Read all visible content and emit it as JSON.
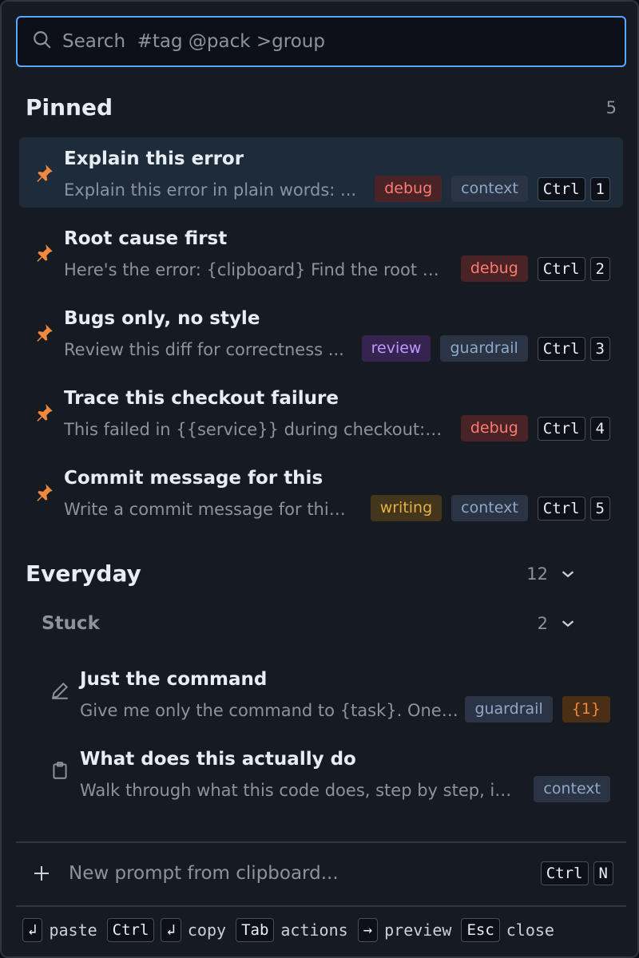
{
  "search": {
    "placeholder": "Search  #tag @pack >group",
    "value": ""
  },
  "pinned": {
    "title": "Pinned",
    "count": "5",
    "items": [
      {
        "title": "Explain this error",
        "desc": "Explain this error in plain words: ...",
        "tags": [
          "debug",
          "context"
        ],
        "keys": [
          "Ctrl",
          "1"
        ]
      },
      {
        "title": "Root cause first",
        "desc": "Here's the error: {clipboard} Find the root c...",
        "tags": [
          "debug"
        ],
        "keys": [
          "Ctrl",
          "2"
        ]
      },
      {
        "title": "Bugs only, no style",
        "desc": "Review this diff for correctness ...",
        "tags": [
          "review",
          "guardrail"
        ],
        "keys": [
          "Ctrl",
          "3"
        ]
      },
      {
        "title": "Trace this checkout failure",
        "desc": "This failed in {{service}} during checkout: {cl...",
        "tags": [
          "debug"
        ],
        "keys": [
          "Ctrl",
          "4"
        ]
      },
      {
        "title": "Commit message for this",
        "desc": "Write a commit message for this...",
        "tags": [
          "writing",
          "context"
        ],
        "keys": [
          "Ctrl",
          "5"
        ]
      }
    ]
  },
  "everyday": {
    "title": "Everyday",
    "count": "12",
    "group": {
      "title": "Stuck",
      "count": "2",
      "items": [
        {
          "title": "Just the command",
          "desc": "Give me only the command to {task}. One li...",
          "tags": [
            "guardrail",
            "{1}"
          ],
          "icon": "pencil-icon"
        },
        {
          "title": "What does this actually do",
          "desc": "Walk through what this code does, step by step, in...",
          "tags": [
            "context"
          ],
          "icon": "clipboard-icon"
        }
      ]
    }
  },
  "new_prompt": {
    "label": "New prompt from clipboard...",
    "keys": [
      "Ctrl",
      "N"
    ]
  },
  "footer": {
    "paste_key": "↲",
    "paste_label": "paste",
    "copy_key1": "Ctrl",
    "copy_key2": "↲",
    "copy_label": "copy",
    "actions_key": "Tab",
    "actions_label": "actions",
    "preview_key": "→",
    "preview_label": "preview",
    "close_key": "Esc",
    "close_label": "close"
  },
  "colors": {
    "accent": "#58a6ff",
    "pin": "#f0883e",
    "selected_bg": "#1d2b3a"
  }
}
